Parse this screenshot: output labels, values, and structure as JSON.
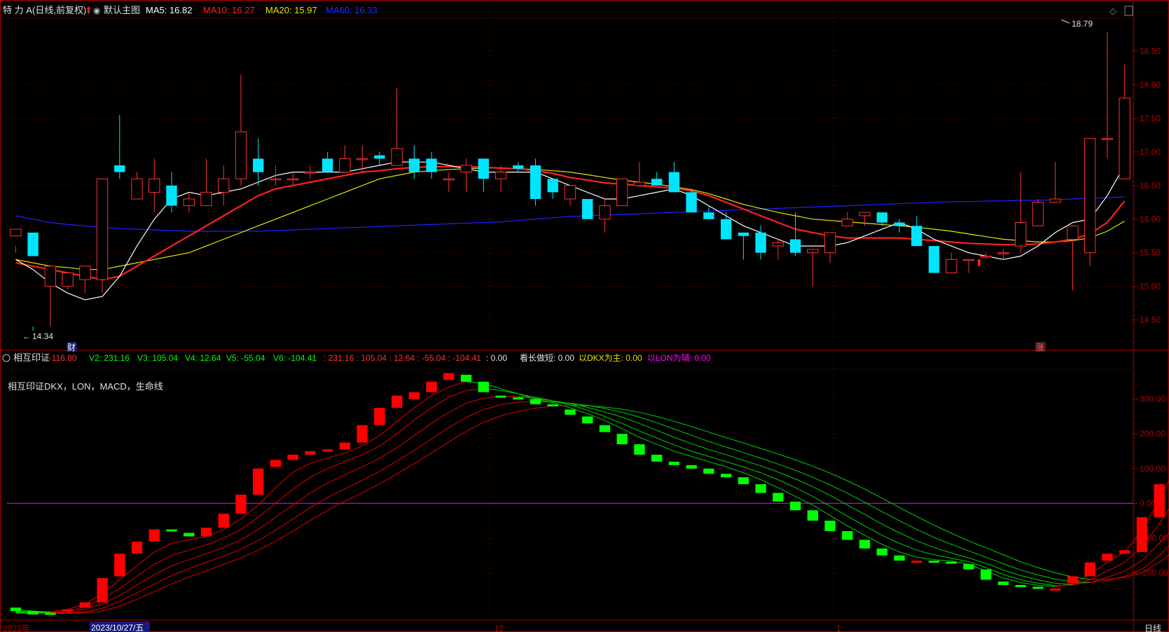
{
  "header": {
    "stock_name": "特 力 A",
    "period": "(日线,前复权)",
    "template": "默认主图",
    "ma5": "MA5: 16.82",
    "ma10": "MA10: 16.27",
    "ma20": "MA20: 15.97",
    "ma60": "MA60: 16.33"
  },
  "indicator_header": {
    "name": "相互印证",
    "v1": ": -116.80",
    "v2": "V2: 231.16",
    "v3": "V3: 105.04",
    "v4": "V4: 12.64",
    "v5": "V5: -55.04",
    "v6": "V6: -104.41",
    "extra": ": 231.16 : 105.04 : 12.64 : -55.04 : -104.41",
    "zero": ": 0.00",
    "kan": "看长做短: 0.00",
    "dkx": "以DKX为主: 0.00",
    "lon": "以LON为辅: 0.00",
    "desc": "相互印证DKX，LON，MACD，生命线"
  },
  "markers": {
    "high": "18.79",
    "low": "14.34",
    "cai": "财",
    "zhang": "涨"
  },
  "xaxis": {
    "year": "2023年",
    "cursor_date": "2023/10/27/五",
    "m12": "12",
    "m1": "1",
    "period_btn": "日线"
  },
  "colors": {
    "up": "#ff3030",
    "down": "#00e5ff",
    "ma5": "#ffffff",
    "ma10": "#ff2020",
    "ma20": "#e6e600",
    "ma60": "#2020ff",
    "ind_up": "#ff0000",
    "ind_down": "#00ff00",
    "zero_line": "#cc00cc",
    "frame": "#b00000"
  },
  "chart_data": [
    {
      "type": "candlestick",
      "yticks": [
        14.5,
        15.0,
        15.5,
        16.0,
        16.5,
        17.0,
        17.5,
        18.0,
        18.5
      ],
      "ylim": [
        14.1,
        19.0
      ],
      "candles": [
        [
          15.75,
          15.85,
          15.6,
          15.5
        ],
        [
          15.8,
          15.45,
          14.4,
          14.34
        ],
        [
          15.0,
          15.3,
          15.2,
          14.4
        ],
        [
          15.0,
          15.2,
          15.0,
          14.95
        ],
        [
          15.1,
          15.3,
          15.2,
          14.9
        ],
        [
          15.1,
          16.6,
          15.1,
          14.9
        ],
        [
          16.8,
          16.7,
          17.55,
          16.6
        ],
        [
          16.3,
          16.6,
          16.7,
          16.3
        ],
        [
          16.4,
          16.6,
          16.9,
          16.1
        ],
        [
          16.5,
          16.2,
          16.7,
          16.1
        ],
        [
          16.2,
          16.3,
          16.4,
          16.1
        ],
        [
          16.2,
          16.4,
          16.9,
          16.2
        ],
        [
          16.4,
          16.6,
          16.8,
          16.2
        ],
        [
          16.6,
          17.3,
          18.15,
          16.5
        ],
        [
          16.9,
          16.7,
          17.2,
          16.5
        ],
        [
          16.6,
          16.6,
          16.8,
          16.5
        ],
        [
          16.6,
          16.6,
          16.7,
          16.5
        ],
        [
          16.7,
          16.7,
          16.8,
          16.6
        ],
        [
          16.9,
          16.7,
          17.0,
          16.7
        ],
        [
          16.7,
          16.9,
          17.1,
          16.7
        ],
        [
          16.9,
          16.9,
          17.1,
          16.7
        ],
        [
          16.95,
          16.9,
          17.0,
          16.8
        ],
        [
          16.8,
          17.05,
          17.95,
          16.8
        ],
        [
          16.9,
          16.7,
          17.1,
          16.6
        ],
        [
          16.9,
          16.7,
          17.0,
          16.6
        ],
        [
          16.6,
          16.6,
          16.7,
          16.4
        ],
        [
          16.7,
          16.8,
          16.9,
          16.4
        ],
        [
          16.9,
          16.6,
          16.9,
          16.4
        ],
        [
          16.6,
          16.7,
          16.8,
          16.4
        ],
        [
          16.8,
          16.75,
          16.85,
          16.7
        ],
        [
          16.8,
          16.3,
          16.9,
          16.2
        ],
        [
          16.6,
          16.4,
          16.6,
          16.3
        ],
        [
          16.3,
          16.5,
          16.5,
          16.2
        ],
        [
          16.3,
          16.0,
          16.3,
          16.0
        ],
        [
          16.0,
          16.2,
          16.3,
          15.8
        ],
        [
          16.2,
          16.6,
          16.6,
          16.2
        ],
        [
          16.5,
          16.55,
          16.85,
          16.5
        ],
        [
          16.6,
          16.5,
          16.7,
          16.5
        ],
        [
          16.7,
          16.4,
          16.85,
          16.4
        ],
        [
          16.4,
          16.1,
          16.45,
          16.1
        ],
        [
          16.1,
          16.0,
          16.2,
          16.0
        ],
        [
          16.0,
          15.7,
          16.1,
          15.7
        ],
        [
          15.8,
          15.75,
          15.8,
          15.4
        ],
        [
          15.8,
          15.5,
          15.9,
          15.4
        ],
        [
          15.6,
          15.65,
          15.7,
          15.4
        ],
        [
          15.7,
          15.5,
          16.1,
          15.45
        ],
        [
          15.5,
          15.55,
          15.55,
          15.0
        ],
        [
          15.5,
          15.8,
          15.8,
          15.35
        ],
        [
          15.9,
          16.0,
          16.1,
          15.9
        ],
        [
          16.05,
          16.1,
          16.1,
          15.9
        ],
        [
          16.1,
          15.95,
          16.1,
          15.9
        ],
        [
          15.95,
          15.9,
          16.0,
          15.8
        ],
        [
          15.9,
          15.6,
          16.05,
          15.6
        ],
        [
          15.6,
          15.2,
          15.6,
          15.2
        ],
        [
          15.2,
          15.4,
          15.5,
          15.2
        ],
        [
          15.4,
          15.4,
          15.4,
          15.2
        ],
        [
          15.45,
          15.45,
          15.5,
          15.4
        ],
        [
          15.5,
          15.5,
          15.55,
          15.4
        ],
        [
          15.6,
          15.95,
          16.7,
          15.5
        ],
        [
          15.9,
          16.25,
          16.3,
          15.9
        ],
        [
          16.25,
          16.3,
          16.85,
          16.25
        ],
        [
          15.7,
          15.9,
          15.9,
          14.94
        ],
        [
          15.5,
          17.2,
          17.2,
          15.3
        ],
        [
          17.2,
          17.2,
          18.79,
          16.9
        ],
        [
          16.6,
          17.8,
          18.3,
          16.6
        ]
      ],
      "ma5": [
        15.4,
        15.25,
        15.05,
        14.9,
        14.8,
        14.85,
        15.15,
        15.6,
        16.0,
        16.3,
        16.4,
        16.35,
        16.4,
        16.45,
        16.55,
        16.65,
        16.7,
        16.7,
        16.7,
        16.7,
        16.75,
        16.8,
        16.85,
        16.85,
        16.85,
        16.8,
        16.75,
        16.7,
        16.7,
        16.7,
        16.7,
        16.6,
        16.5,
        16.4,
        16.3,
        16.3,
        16.35,
        16.4,
        16.45,
        16.35,
        16.2,
        16.05,
        15.9,
        15.8,
        15.7,
        15.6,
        15.6,
        15.6,
        15.65,
        15.75,
        15.85,
        15.95,
        15.85,
        15.7,
        15.6,
        15.5,
        15.45,
        15.4,
        15.45,
        15.6,
        15.8,
        15.95,
        16.0,
        16.35,
        16.8
      ],
      "ma10": [
        15.35,
        15.3,
        15.25,
        15.2,
        15.15,
        15.1,
        15.15,
        15.3,
        15.45,
        15.6,
        15.75,
        15.9,
        16.05,
        16.2,
        16.35,
        16.45,
        16.5,
        16.55,
        16.6,
        16.65,
        16.7,
        16.72,
        16.75,
        16.77,
        16.78,
        16.78,
        16.78,
        16.77,
        16.76,
        16.75,
        16.72,
        16.68,
        16.62,
        16.58,
        16.54,
        16.52,
        16.5,
        16.48,
        16.46,
        16.42,
        16.35,
        16.25,
        16.15,
        16.05,
        15.95,
        15.85,
        15.8,
        15.75,
        15.72,
        15.72,
        15.72,
        15.72,
        15.7,
        15.68,
        15.66,
        15.64,
        15.63,
        15.62,
        15.62,
        15.63,
        15.66,
        15.7,
        15.78,
        15.95,
        16.27
      ],
      "ma20": [
        15.4,
        15.35,
        15.3,
        15.28,
        15.25,
        15.25,
        15.3,
        15.35,
        15.4,
        15.45,
        15.5,
        15.6,
        15.7,
        15.8,
        15.9,
        16.0,
        16.1,
        16.2,
        16.3,
        16.4,
        16.5,
        16.6,
        16.65,
        16.7,
        16.72,
        16.74,
        16.75,
        16.76,
        16.76,
        16.75,
        16.74,
        16.72,
        16.7,
        16.66,
        16.62,
        16.58,
        16.55,
        16.52,
        16.48,
        16.44,
        16.38,
        16.3,
        16.22,
        16.16,
        16.1,
        16.05,
        16.0,
        15.98,
        15.96,
        15.94,
        15.92,
        15.9,
        15.88,
        15.85,
        15.82,
        15.78,
        15.74,
        15.7,
        15.68,
        15.66,
        15.66,
        15.68,
        15.72,
        15.82,
        15.97
      ],
      "ma60": [
        16.05,
        16.0,
        15.95,
        15.92,
        15.9,
        15.88,
        15.86,
        15.85,
        15.84,
        15.83,
        15.82,
        15.82,
        15.82,
        15.82,
        15.82,
        15.83,
        15.84,
        15.85,
        15.86,
        15.87,
        15.88,
        15.89,
        15.9,
        15.91,
        15.92,
        15.93,
        15.94,
        15.95,
        15.96,
        15.98,
        16.0,
        16.02,
        16.04,
        16.05,
        16.06,
        16.07,
        16.08,
        16.09,
        16.1,
        16.11,
        16.12,
        16.13,
        16.14,
        16.15,
        16.16,
        16.17,
        16.18,
        16.19,
        16.2,
        16.21,
        16.22,
        16.23,
        16.24,
        16.25,
        16.26,
        16.26,
        16.27,
        16.27,
        16.28,
        16.28,
        16.29,
        16.3,
        16.31,
        16.32,
        16.33
      ]
    },
    {
      "type": "bar",
      "yticks": [
        300,
        200,
        100,
        0,
        -100,
        -200
      ],
      "ylim": [
        -330,
        400
      ],
      "bars": [
        [
          -300,
          -310
        ],
        [
          -310,
          -320
        ],
        [
          -315,
          -318
        ],
        [
          -310,
          -305
        ],
        [
          -300,
          -285
        ],
        [
          -285,
          -215
        ],
        [
          -210,
          -145
        ],
        [
          -145,
          -110
        ],
        [
          -110,
          -75
        ],
        [
          -75,
          -80
        ],
        [
          -85,
          -95
        ],
        [
          -95,
          -70
        ],
        [
          -70,
          -30
        ],
        [
          -30,
          25
        ],
        [
          25,
          100
        ],
        [
          105,
          125
        ],
        [
          125,
          140
        ],
        [
          140,
          150
        ],
        [
          150,
          155
        ],
        [
          155,
          175
        ],
        [
          175,
          225
        ],
        [
          225,
          275
        ],
        [
          275,
          310
        ],
        [
          300,
          320
        ],
        [
          320,
          350
        ],
        [
          355,
          375
        ],
        [
          370,
          350
        ],
        [
          350,
          320
        ],
        [
          310,
          305
        ],
        [
          305,
          300
        ],
        [
          300,
          285
        ],
        [
          285,
          280
        ],
        [
          270,
          255
        ],
        [
          250,
          230
        ],
        [
          225,
          205
        ],
        [
          200,
          170
        ],
        [
          170,
          140
        ],
        [
          140,
          120
        ],
        [
          120,
          110
        ],
        [
          110,
          100
        ],
        [
          100,
          85
        ],
        [
          85,
          75
        ],
        [
          75,
          55
        ],
        [
          55,
          30
        ],
        [
          30,
          5
        ],
        [
          5,
          -20
        ],
        [
          -20,
          -50
        ],
        [
          -50,
          -80
        ],
        [
          -80,
          -105
        ],
        [
          -105,
          -130
        ],
        [
          -130,
          -150
        ],
        [
          -150,
          -165
        ],
        [
          -165,
          -165
        ],
        [
          -165,
          -168
        ],
        [
          -168,
          -170
        ],
        [
          -175,
          -190
        ],
        [
          -190,
          -220
        ],
        [
          -225,
          -235
        ],
        [
          -235,
          -240
        ],
        [
          -240,
          -245
        ],
        [
          -245,
          -245
        ],
        [
          -230,
          -210
        ],
        [
          -210,
          -170
        ],
        [
          -165,
          -145
        ],
        [
          -145,
          -135
        ],
        [
          -140,
          -40
        ],
        [
          -40,
          55
        ],
        [
          55,
          230
        ]
      ],
      "lines": [
        [
          -305,
          -310,
          -312,
          -305,
          -290,
          -260,
          -220,
          -180,
          -140,
          -115,
          -105,
          -95,
          -75,
          -45,
          -5,
          45,
          90,
          115,
          130,
          145,
          165,
          195,
          235,
          275,
          310,
          335,
          350,
          345,
          330,
          315,
          300,
          290,
          275,
          258,
          238,
          215,
          190,
          170,
          150,
          135,
          120,
          105,
          88,
          68,
          45,
          20,
          -5,
          -35,
          -65,
          -92,
          -118,
          -140,
          -155,
          -162,
          -166,
          -175,
          -195,
          -215,
          -228,
          -236,
          -240,
          -232,
          -205,
          -170,
          -140,
          -80,
          10,
          110,
          160
        ],
        [
          -310,
          -312,
          -314,
          -310,
          -298,
          -275,
          -245,
          -210,
          -175,
          -150,
          -135,
          -120,
          -100,
          -75,
          -40,
          0,
          40,
          75,
          100,
          120,
          140,
          165,
          200,
          240,
          275,
          305,
          325,
          330,
          325,
          315,
          305,
          295,
          283,
          268,
          250,
          230,
          208,
          188,
          168,
          150,
          135,
          120,
          105,
          88,
          68,
          45,
          20,
          -8,
          -37,
          -65,
          -92,
          -115,
          -135,
          -148,
          -158,
          -168,
          -185,
          -205,
          -220,
          -230,
          -237,
          -235,
          -220,
          -195,
          -170,
          -125,
          -60,
          20,
          70
        ],
        [
          -312,
          -314,
          -315,
          -314,
          -305,
          -290,
          -265,
          -235,
          -205,
          -180,
          -162,
          -145,
          -127,
          -105,
          -75,
          -40,
          -5,
          30,
          58,
          82,
          105,
          130,
          160,
          195,
          230,
          262,
          288,
          303,
          308,
          308,
          302,
          295,
          287,
          276,
          263,
          248,
          230,
          210,
          190,
          172,
          155,
          140,
          124,
          108,
          90,
          70,
          48,
          23,
          -5,
          -32,
          -60,
          -85,
          -108,
          -127,
          -143,
          -157,
          -173,
          -192,
          -208,
          -220,
          -230,
          -234,
          -228,
          -213,
          -195,
          -165,
          -115,
          -60,
          -5
        ],
        [
          -314,
          -315,
          -316,
          -316,
          -312,
          -302,
          -282,
          -258,
          -232,
          -208,
          -188,
          -170,
          -152,
          -132,
          -107,
          -77,
          -45,
          -12,
          17,
          42,
          66,
          92,
          122,
          153,
          185,
          218,
          247,
          270,
          284,
          291,
          293,
          292,
          288,
          282,
          273,
          262,
          248,
          232,
          214,
          196,
          178,
          162,
          146,
          130,
          113,
          95,
          75,
          53,
          29,
          3,
          -24,
          -50,
          -75,
          -98,
          -118,
          -137,
          -155,
          -174,
          -192,
          -206,
          -218,
          -226,
          -228,
          -222,
          -210,
          -190,
          -150,
          -100,
          -55
        ],
        [
          -316,
          -317,
          -317,
          -317,
          -315,
          -310,
          -296,
          -276,
          -254,
          -232,
          -212,
          -194,
          -176,
          -157,
          -135,
          -109,
          -80,
          -49,
          -20,
          6,
          30,
          56,
          85,
          114,
          145,
          177,
          207,
          233,
          252,
          265,
          274,
          280,
          282,
          281,
          277,
          271,
          262,
          250,
          236,
          221,
          205,
          189,
          174,
          158,
          142,
          125,
          107,
          87,
          65,
          41,
          15,
          -12,
          -38,
          -63,
          -86,
          -108,
          -128,
          -148,
          -168,
          -185,
          -200,
          -212,
          -219,
          -219,
          -213,
          -200,
          -170,
          -130,
          -90
        ]
      ]
    }
  ]
}
